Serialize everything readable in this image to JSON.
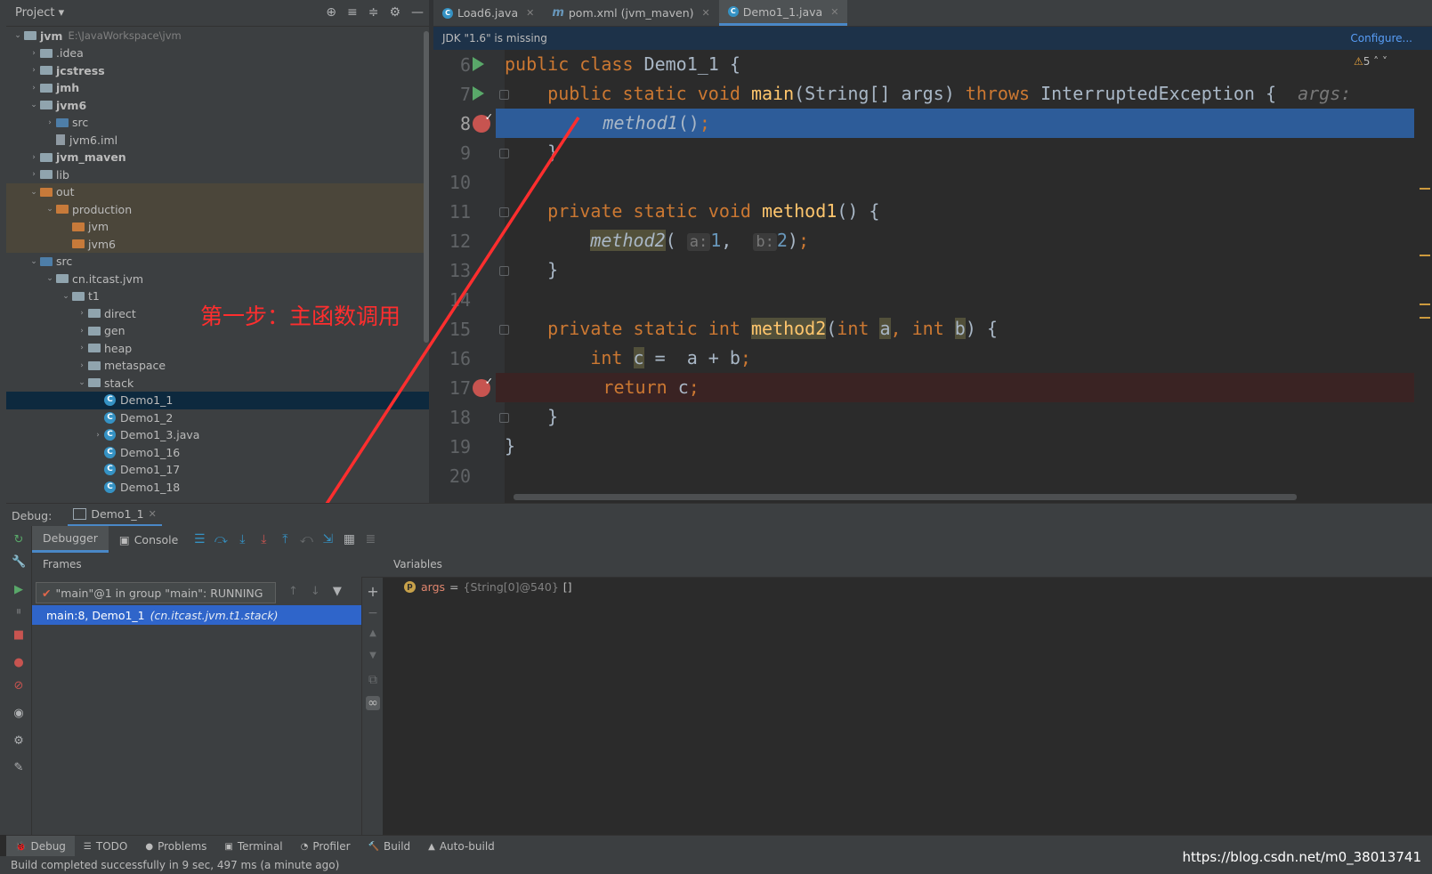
{
  "project": {
    "title": "Project",
    "tree": [
      {
        "label": "jvm",
        "path": "E:\\JavaWorkspace\\jvm",
        "arrow": "v",
        "indent": 0,
        "icon": "folder",
        "bold": true
      },
      {
        "label": ".idea",
        "arrow": ">",
        "indent": 1,
        "icon": "folder"
      },
      {
        "label": "jcstress",
        "arrow": ">",
        "indent": 1,
        "icon": "folder",
        "bold": true
      },
      {
        "label": "jmh",
        "arrow": ">",
        "indent": 1,
        "icon": "folder",
        "bold": true
      },
      {
        "label": "jvm6",
        "arrow": "v",
        "indent": 1,
        "icon": "folder",
        "bold": true
      },
      {
        "label": "src",
        "arrow": ">",
        "indent": 2,
        "icon": "folder-blue"
      },
      {
        "label": "jvm6.iml",
        "arrow": "",
        "indent": 2,
        "icon": "iml"
      },
      {
        "label": "jvm_maven",
        "arrow": ">",
        "indent": 1,
        "icon": "folder",
        "bold": true
      },
      {
        "label": "lib",
        "arrow": ">",
        "indent": 1,
        "icon": "folder"
      },
      {
        "label": "out",
        "arrow": "v",
        "indent": 1,
        "icon": "folder-orange",
        "hl": true
      },
      {
        "label": "production",
        "arrow": "v",
        "indent": 2,
        "icon": "folder-orange",
        "hl": true
      },
      {
        "label": "jvm",
        "arrow": "",
        "indent": 3,
        "icon": "folder-orange",
        "hl": true
      },
      {
        "label": "jvm6",
        "arrow": "",
        "indent": 3,
        "icon": "folder-orange",
        "hl": true
      },
      {
        "label": "src",
        "arrow": "v",
        "indent": 1,
        "icon": "folder-blue"
      },
      {
        "label": "cn.itcast.jvm",
        "arrow": "v",
        "indent": 2,
        "icon": "folder"
      },
      {
        "label": "t1",
        "arrow": "v",
        "indent": 3,
        "icon": "folder"
      },
      {
        "label": "direct",
        "arrow": ">",
        "indent": 4,
        "icon": "folder"
      },
      {
        "label": "gen",
        "arrow": ">",
        "indent": 4,
        "icon": "folder"
      },
      {
        "label": "heap",
        "arrow": ">",
        "indent": 4,
        "icon": "folder"
      },
      {
        "label": "metaspace",
        "arrow": ">",
        "indent": 4,
        "icon": "folder"
      },
      {
        "label": "stack",
        "arrow": "v",
        "indent": 4,
        "icon": "folder"
      },
      {
        "label": "Demo1_1",
        "arrow": "",
        "indent": 5,
        "icon": "class",
        "selected": true
      },
      {
        "label": "Demo1_2",
        "arrow": "",
        "indent": 5,
        "icon": "class"
      },
      {
        "label": "Demo1_3.java",
        "arrow": ">",
        "indent": 5,
        "icon": "class"
      },
      {
        "label": "Demo1_16",
        "arrow": "",
        "indent": 5,
        "icon": "class"
      },
      {
        "label": "Demo1_17",
        "arrow": "",
        "indent": 5,
        "icon": "class"
      },
      {
        "label": "Demo1_18",
        "arrow": "",
        "indent": 5,
        "icon": "class"
      }
    ]
  },
  "editor": {
    "tabs": [
      {
        "label": "Load6.java",
        "icon": "C"
      },
      {
        "label": "pom.xml (jvm_maven)",
        "icon": "m"
      },
      {
        "label": "Demo1_1.java",
        "icon": "C",
        "active": true
      }
    ],
    "jdk_message": "JDK \"1.6\" is missing",
    "configure_label": "Configure...",
    "warning_count": "5",
    "line_numbers": [
      "6",
      "7",
      "8",
      "9",
      "10",
      "11",
      "12",
      "13",
      "14",
      "15",
      "16",
      "17",
      "18",
      "19",
      "20"
    ],
    "code": {
      "l6_kw": "public class ",
      "l6_rest": "Demo1_1 {",
      "l7_kw": "public static void ",
      "l7_fn": "main",
      "l7_args": "(String[] args) ",
      "l7_throws": "throws ",
      "l7_exc": "InterruptedException {",
      "l7_hint": "args:",
      "l8_call": "method1",
      "l8_rest": "()",
      "l8_semi": ";",
      "close": "}",
      "l11_kw": "private static void ",
      "l11_fn": "method1",
      "l11_rest": "() {",
      "l12_call": "method2",
      "l12_hint_a": "a:",
      "l12_val_a": "1",
      "l12_hint_b": "b:",
      "l12_val_b": "2",
      "l15_kw": "private static int ",
      "l15_fn": "method2",
      "l15_int": "int ",
      "l15_a": "a",
      "l15_b": "b",
      "l16_int": "int ",
      "l16_c": "c",
      "l16_rest": " =  a + b",
      "l17_return": "return ",
      "l17_rest": "c"
    }
  },
  "annotation": "第一步：主函数调用",
  "debug": {
    "label": "Debug:",
    "session": "Demo1_1",
    "tabs": [
      "Debugger",
      "Console"
    ],
    "frames_title": "Frames",
    "thread": "\"main\"@1 in group \"main\": RUNNING",
    "frame_location": "main:8, Demo1_1",
    "frame_package": "(cn.itcast.jvm.t1.stack)",
    "variables_title": "Variables",
    "variable": {
      "name": "args",
      "value": "{String[0]@540}",
      "extra": "[]"
    }
  },
  "bottom_tabs": [
    "Debug",
    "TODO",
    "Problems",
    "Terminal",
    "Profiler",
    "Build",
    "Auto-build"
  ],
  "status": "Build completed successfully in 9 sec, 497 ms (a minute ago)",
  "watermark": "https://blog.csdn.net/m0_38013741",
  "colors": {
    "accent": "#4a88c7",
    "exec_line": "#2d5c99",
    "annotation": "#ff2e2e",
    "keyword": "#cc7832",
    "function": "#ffc66d"
  }
}
